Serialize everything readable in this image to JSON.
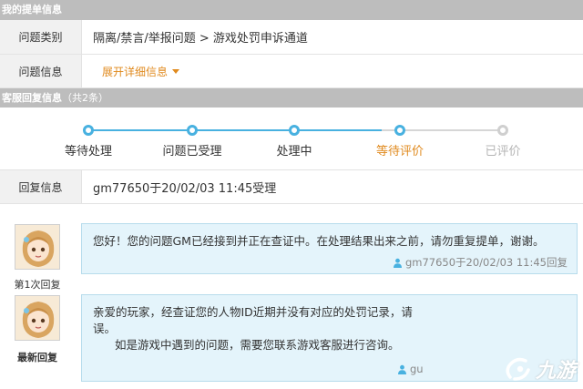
{
  "ticket": {
    "section_title": "我的提单信息",
    "category_label": "问题类别",
    "category_value": "隔离/禁言/举报问题 > 游戏处罚申诉通道",
    "info_label": "问题信息",
    "info_expand": "展开详细信息"
  },
  "reply_section": {
    "title": "客服回复信息",
    "count": "（共2条）"
  },
  "progress": {
    "steps": [
      {
        "label": "等待处理",
        "state": "done"
      },
      {
        "label": "问题已受理",
        "state": "done"
      },
      {
        "label": "处理中",
        "state": "done"
      },
      {
        "label": "等待评价",
        "state": "current"
      },
      {
        "label": "已评价",
        "state": "pending"
      }
    ]
  },
  "reply_info": {
    "label": "回复信息",
    "value": "gm77650于20/02/03 11:45受理"
  },
  "messages": [
    {
      "tag": "第1次回复",
      "text": "您好！您的问题GM已经接到并正在查证中。在处理结果出来之前，请勿重复提单，谢谢。",
      "sign": "gm77650于20/02/03 11:45回复"
    },
    {
      "tag": "最新回复",
      "text_line1": "亲爱的玩家，经查证您的人物ID近期并没有对应的处罚记录，请",
      "text_line2": "误。",
      "text_line3": "如是游戏中遇到的问题，需要您联系游戏客服进行咨询。",
      "sign": "gu"
    }
  ],
  "watermark": {
    "text": "九游"
  },
  "colors": {
    "accent_blue": "#48b1e0",
    "accent_orange": "#e08a1e",
    "bubble_bg": "#e4f4fb",
    "section_bar": "#bdbdbd"
  }
}
